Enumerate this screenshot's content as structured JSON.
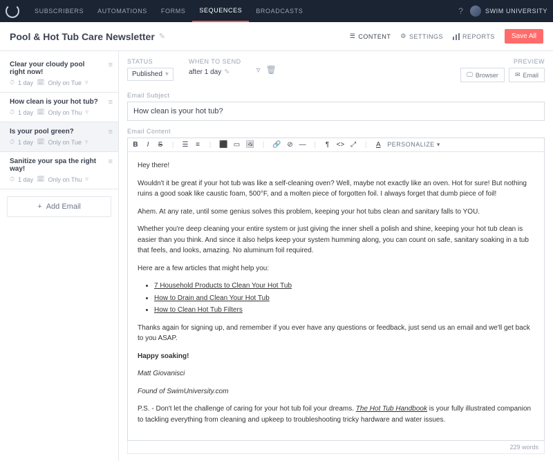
{
  "nav": {
    "items": [
      "SUBSCRIBERS",
      "AUTOMATIONS",
      "FORMS",
      "SEQUENCES",
      "BROADCASTS"
    ],
    "user": "SWIM UNIVERSITY",
    "help": "?"
  },
  "header": {
    "title": "Pool & Hot Tub Care Newsletter",
    "tabs": {
      "content": "CONTENT",
      "settings": "SETTINGS",
      "reports": "REPORTS"
    },
    "save": "Save All"
  },
  "sidebar": {
    "items": [
      {
        "title": "Clear your cloudy pool right now!",
        "delay": "1 day",
        "ext": "Only on Tue"
      },
      {
        "title": "How clean is your hot tub?",
        "delay": "1 day",
        "ext": "Only on Thu"
      },
      {
        "title": "Is your pool green?",
        "delay": "1 day",
        "ext": "Only on Tue"
      },
      {
        "title": "Sanitize your spa the right way!",
        "delay": "1 day",
        "ext": "Only on Thu"
      }
    ],
    "add": "Add Email"
  },
  "editor": {
    "labels": {
      "status": "STATUS",
      "when": "WHEN TO SEND",
      "preview": "PREVIEW",
      "subject": "Email Subject",
      "content": "Email Content"
    },
    "status": "Published",
    "when": "after 1 day",
    "preview": {
      "browser": "Browser",
      "email": "Email"
    },
    "subject": "How clean is your hot tub?",
    "personalize": "PERSONALIZE",
    "body": {
      "greeting": "Hey there!",
      "p1": "Wouldn't it be great if your hot tub was like a self-cleaning oven? Well, maybe not exactly like an oven. Hot for sure! But nothing ruins a good soak like caustic foam, 500°F, and a molten piece of forgotten foil. I always forget that dumb piece of foil!",
      "p2": "Ahem. At any rate, until some genius solves this problem, keeping your hot tubs clean and sanitary falls to YOU.",
      "p3": "Whether you're deep cleaning your entire system or just giving the inner shell a polish and shine, keeping your hot tub clean is easier than you think. And since it also helps keep your system humming along, you can count on safe, sanitary soaking in a tub that feels, and looks, amazing. No aluminum foil required.",
      "p4": "Here are a few articles that might help you:",
      "links": [
        "7 Household Products to Clean Your Hot Tub",
        "How to Drain and Clean Your Hot Tub",
        "How to Clean Hot Tub Filters"
      ],
      "p5": "Thanks again for signing up, and remember if you ever have any questions or feedback, just send us an email and we'll get back to you ASAP.",
      "closing": "Happy soaking!",
      "sig_name": "Matt Giovanisci",
      "sig_title": "Found of SwimUniversity.com",
      "ps_pre": "P.S. - Don't let the challenge of caring for your hot tub foil your dreams. ",
      "ps_link": "The Hot Tub Handbook",
      "ps_post": " is your fully illustrated companion to tackling everything from cleaning and upkeep to troubleshooting tricky hardware and water issues."
    },
    "wordcount": "229 words"
  }
}
